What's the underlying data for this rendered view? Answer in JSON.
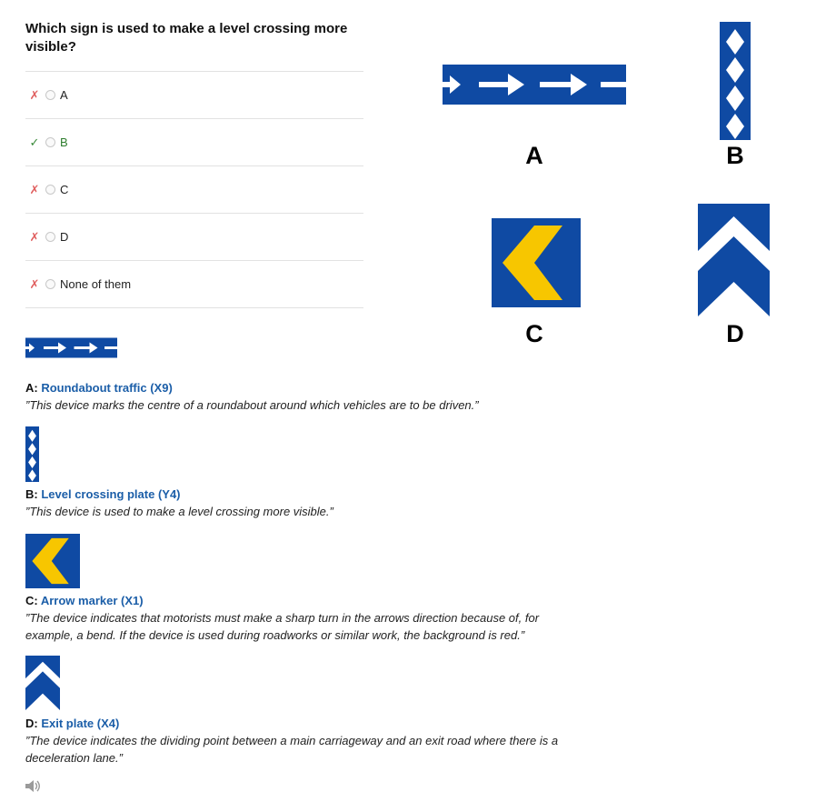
{
  "question": "Which sign is used to make a level crossing more visible?",
  "answers": [
    {
      "label": "A",
      "result": "wrong",
      "mark": "✗"
    },
    {
      "label": "B",
      "result": "correct",
      "mark": "✓"
    },
    {
      "label": "C",
      "result": "wrong",
      "mark": "✗"
    },
    {
      "label": "D",
      "result": "wrong",
      "mark": "✗"
    },
    {
      "label": "None of them",
      "result": "wrong",
      "mark": "✗"
    }
  ],
  "sign_letters": {
    "a": "A",
    "b": "B",
    "c": "C",
    "d": "D"
  },
  "colors": {
    "sign_blue": "#0f4aa3",
    "sign_yellow": "#f7c600",
    "link": "#1b5ea8",
    "correct": "#2e7d2e",
    "wrong": "#e06060"
  },
  "explanations": [
    {
      "prefix": "A:",
      "title": "Roundabout traffic (X9)",
      "quote": "”This device marks the centre of a roundabout around which vehicles are to be driven.”"
    },
    {
      "prefix": "B:",
      "title": "Level crossing plate (Y4)",
      "quote": "”This device is used to make a level crossing more visible.”"
    },
    {
      "prefix": "C:",
      "title": "Arrow marker (X1)",
      "quote": "”The device indicates that motorists must make a sharp turn in the arrows direction because of, for example, a bend. If the device is used during roadworks or similar work, the background is red.”"
    },
    {
      "prefix": "D:",
      "title": "Exit plate (X4)",
      "quote": "”The device indicates the dividing point between a main carriageway and an exit road where there is a deceleration lane.”"
    }
  ],
  "icons": {
    "speaker": "speaker-icon"
  }
}
